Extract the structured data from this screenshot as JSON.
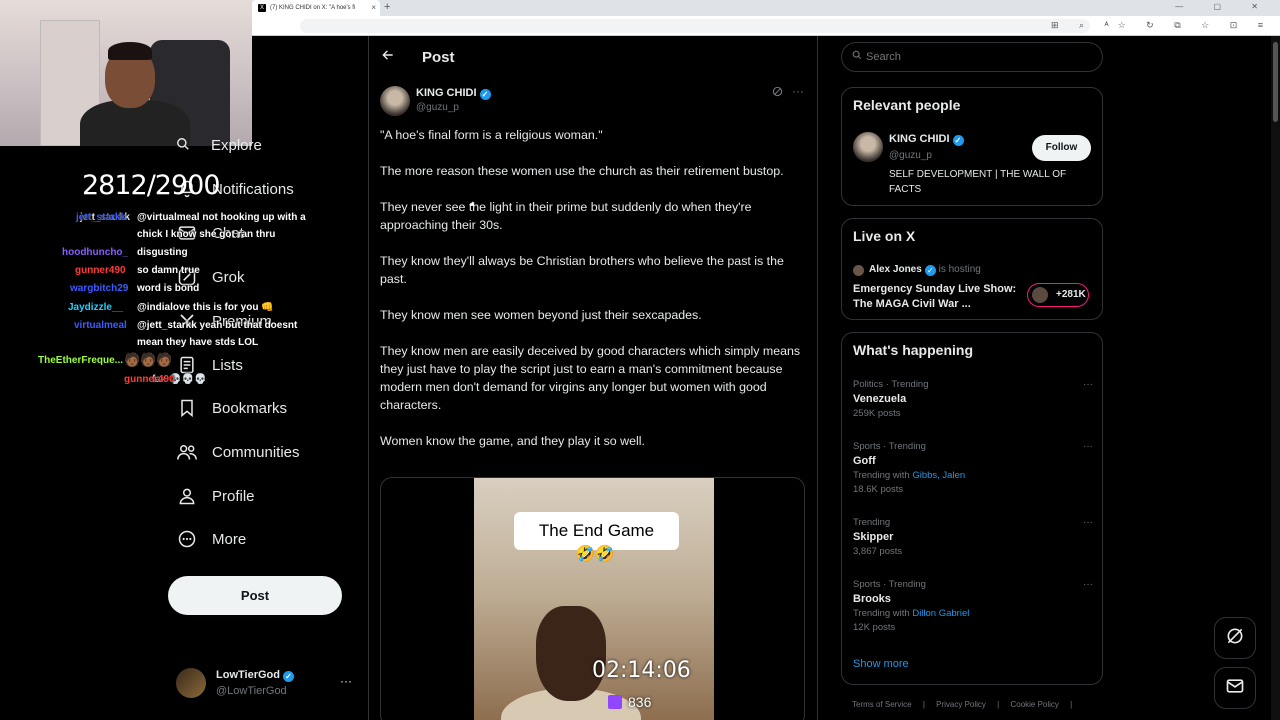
{
  "browser": {
    "tab_title": "(7) KING CHIDI on X: \"A hoe's fi",
    "tab_favicon": "X",
    "tab_close": "×",
    "new_tab": "+",
    "window_controls": "— ▢ ✕",
    "toolbar_icons": "⊞ ⌕ ᴬ☆ ↻ ⧉ ☆ ⊡ ≡"
  },
  "nav": {
    "explore": "Explore",
    "notifications": "Notifications",
    "chat": "Chat",
    "grok": "Grok",
    "premium": "Premium",
    "lists": "Lists",
    "bookmarks": "Bookmarks",
    "communities": "Communities",
    "profile": "Profile",
    "more": "More",
    "post_button": "Post"
  },
  "account": {
    "name": "LowTierGod",
    "handle": "@LowTierGod",
    "more": "···"
  },
  "post": {
    "header_title": "Post",
    "author_name": "KING CHIDI",
    "author_handle": "@guzu_p",
    "paragraphs": [
      "\"A hoe's final form is a religious woman.\"",
      "The more reason these women use the church as their retirement bustop.",
      "They never see the light in their prime but suddenly do when they're approaching their 30s.",
      "They know they'll always be Christian brothers who believe the past is the past.",
      "They know men see women beyond just their sexcapades.",
      "They know men are easily deceived by good characters which simply means they just have to play the script just to earn a man's commitment because modern men don't demand for virgins any longer but women with good characters.",
      "Women know the game, and they play it so well."
    ],
    "media_caption": "The End Game",
    "media_emoji": "🤣🤣"
  },
  "search": {
    "placeholder": "Search"
  },
  "relevant_people": {
    "title": "Relevant people",
    "name": "KING CHIDI",
    "handle": "@guzu_p",
    "bio": "SELF DEVELOPMENT | THE WALL OF FACTS",
    "follow_label": "Follow"
  },
  "live": {
    "title": "Live on X",
    "host_name": "Alex Jones",
    "host_suffix": "is hosting",
    "stream_title": "Emergency Sunday Live Show: The MAGA Civil War ...",
    "listener_count": "+281K"
  },
  "happening": {
    "title": "What's happening",
    "trends": [
      {
        "meta": "Politics · Trending",
        "name": "Venezuela",
        "with_prefix": "",
        "with_links": "",
        "posts": "259K posts"
      },
      {
        "meta": "Sports · Trending",
        "name": "Goff",
        "with_prefix": "Trending with",
        "with_links": "Gibbs, Jalen",
        "posts": "18.6K posts"
      },
      {
        "meta": "Trending",
        "name": "Skipper",
        "with_prefix": "",
        "with_links": "",
        "posts": "3,867 posts"
      },
      {
        "meta": "Sports · Trending",
        "name": "Brooks",
        "with_prefix": "Trending with",
        "with_links": "Dillon Gabriel",
        "posts": "12K posts"
      }
    ],
    "show_more": "Show more"
  },
  "footer": {
    "terms": "Terms of Service",
    "privacy": "Privacy Policy",
    "cookie": "Cookie Policy",
    "sep": "|"
  },
  "stream_overlay": {
    "counter": "2812/2900",
    "timer": "02:14:06",
    "viewers": "836",
    "chat": [
      {
        "user": "jett_starkk",
        "user_color": "#3b5bff",
        "msg": "@virtualmeal not hooking up with a"
      },
      {
        "user": "",
        "user_color": "#ffffff",
        "msg": "chick I know she got ran thru"
      },
      {
        "user": "hoodhuncho_",
        "user_color": "#8a5cff",
        "msg": "disgusting"
      },
      {
        "user": "gunner490",
        "user_color": "#ff3b3b",
        "msg": "so damn true"
      },
      {
        "user": "wargbitch29",
        "user_color": "#3b5bff",
        "msg": "word is bond"
      },
      {
        "user": "Jaydizzle__",
        "user_color": "#1fd1ff",
        "msg": "@indialove this is for you 👊"
      },
      {
        "user": "virtualmeal",
        "user_color": "#3b5bff",
        "msg": "@jett_starkk yeah but that doesnt"
      },
      {
        "user": "",
        "user_color": "#ffffff",
        "msg": "mean they have stds LOL"
      },
      {
        "user": "TheEtherFreque...",
        "user_color": "#9cff3b",
        "msg": ""
      },
      {
        "user": "gunner490",
        "user_color": "#ff3b3b",
        "msg": "fax 💀💀💀"
      }
    ]
  },
  "colors": {
    "accent": "#1d9bf0",
    "live_ring": "#f91880",
    "background": "#000000",
    "border": "#2f3336",
    "muted": "#71767b"
  }
}
